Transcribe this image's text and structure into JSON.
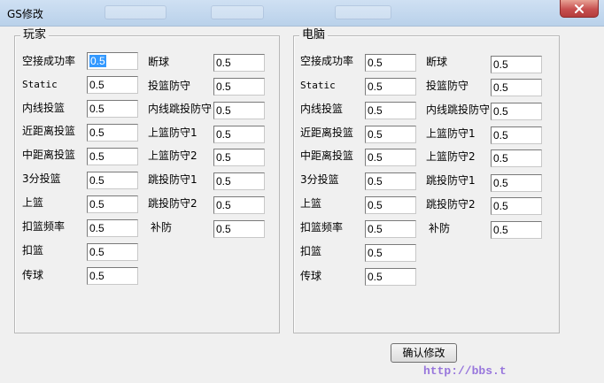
{
  "window": {
    "title": "GS修改"
  },
  "groups": {
    "player": {
      "title": "玩家"
    },
    "computer": {
      "title": "电脑"
    }
  },
  "labels": {
    "rate": "空接成功率",
    "static": "Static",
    "inside": "内线投篮",
    "midrange": "近距离投篮",
    "mid": "中距离投篮",
    "three": "3分投篮",
    "layup": "上篮",
    "dunk_freq": "扣篮频率",
    "dunk": "扣篮",
    "pass": "传球",
    "steal": "断球",
    "shot_def": "投篮防守",
    "post_def": "内线跳投防守",
    "layup_def1": "上篮防守1",
    "layup_def2": "上篮防守2",
    "jump_def1": "跳投防守1",
    "jump_def2": "跳投防守2",
    "help_def": "补防"
  },
  "player": {
    "rate": "0.5",
    "static": "0.5",
    "inside": "0.5",
    "midrange": "0.5",
    "mid": "0.5",
    "three": "0.5",
    "layup": "0.5",
    "dunk_freq": "0.5",
    "dunk": "0.5",
    "pass": "0.5",
    "steal": "0.5",
    "shot_def": "0.5",
    "post_def": "0.5",
    "layup_def1": "0.5",
    "layup_def2": "0.5",
    "jump_def1": "0.5",
    "jump_def2": "0.5",
    "help_def": "0.5"
  },
  "computer": {
    "rate": "0.5",
    "static": "0.5",
    "inside": "0.5",
    "midrange": "0.5",
    "mid": "0.5",
    "three": "0.5",
    "layup": "0.5",
    "dunk_freq": "0.5",
    "dunk": "0.5",
    "pass": "0.5",
    "steal": "0.5",
    "shot_def": "0.5",
    "post_def": "0.5",
    "layup_def1": "0.5",
    "layup_def2": "0.5",
    "jump_def1": "0.5",
    "jump_def2": "0.5",
    "help_def": "0.5"
  },
  "buttons": {
    "confirm": "确认修改"
  },
  "watermark": "http://bbs.t"
}
